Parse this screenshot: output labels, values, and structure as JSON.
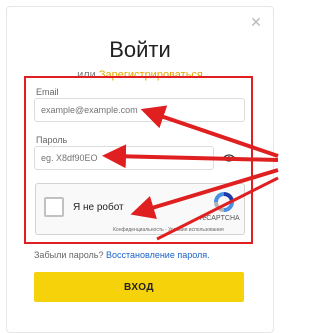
{
  "dialog": {
    "title": "Войти",
    "or_text": "или",
    "register_link": "Зарегистрироваться",
    "close_icon": "close-icon"
  },
  "form": {
    "email_label": "Email",
    "email_placeholder": "example@example.com",
    "password_label": "Пароль",
    "password_placeholder": "eg. X8df90EO",
    "eye_icon": "eye-icon"
  },
  "recaptcha": {
    "label": "Я не робот",
    "brand": "reCAPTCHA",
    "fine_print": "Конфиденциальность - Условия использования"
  },
  "footer": {
    "forgot_text": "Забыли пароль?",
    "restore_link": "Восстановление пароля.",
    "submit_label": "ВХОД"
  },
  "colors": {
    "accent_yellow": "#F5D20A",
    "link_blue": "#1C62C9",
    "annotation_red": "#E02020"
  }
}
